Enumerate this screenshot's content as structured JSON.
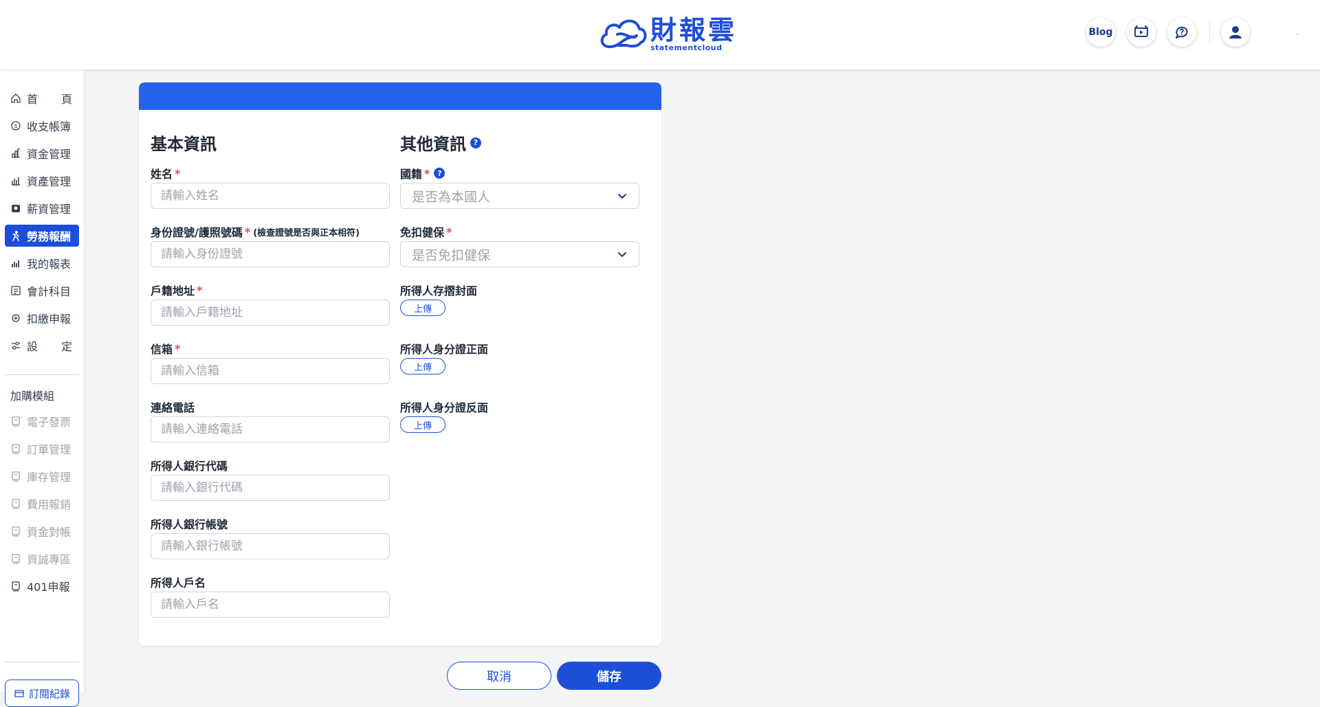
{
  "brand": {
    "name": "財報雲",
    "subtitle": "statementcloud",
    "color": "#1d4ed8"
  },
  "header": {
    "blog_label": "Blog",
    "icons": [
      "video-guide-icon",
      "chat-help-icon",
      "user-icon"
    ],
    "trailing_mark": "."
  },
  "sidebar": {
    "items": [
      {
        "label": "首",
        "label2": "頁",
        "icon": "home-icon"
      },
      {
        "label": "收支帳簿",
        "icon": "ledger-icon"
      },
      {
        "label": "資金管理",
        "icon": "funds-icon"
      },
      {
        "label": "資產管理",
        "icon": "assets-icon"
      },
      {
        "label": "薪資管理",
        "icon": "payroll-icon"
      },
      {
        "label": "勞務報酬",
        "icon": "labor-icon",
        "active": true
      },
      {
        "label": "我的報表",
        "icon": "report-icon"
      },
      {
        "label": "會計科目",
        "icon": "accounts-icon"
      },
      {
        "label": "扣繳申報",
        "icon": "withholding-icon"
      },
      {
        "label": "設",
        "label2": "定",
        "icon": "settings-icon"
      }
    ],
    "addon_title": "加購模組",
    "addons": [
      {
        "label": "電子發票",
        "disabled": true
      },
      {
        "label": "訂單管理",
        "disabled": true
      },
      {
        "label": "庫存管理",
        "disabled": true
      },
      {
        "label": "費用報銷",
        "disabled": true
      },
      {
        "label": "資金對帳",
        "disabled": true
      },
      {
        "label": "資誠專區",
        "disabled": true
      },
      {
        "label": "401申報",
        "disabled": false
      }
    ],
    "subscribe_label": "訂閱紀錄"
  },
  "form": {
    "basic_title": "基本資訊",
    "other_title": "其他資訊",
    "fields": {
      "name": {
        "label": "姓名",
        "placeholder": "請輸入姓名",
        "required": "*"
      },
      "id": {
        "label": "身份證號/護照號碼",
        "required": "*",
        "hint": "(檢查證號是否與正本相符)",
        "placeholder": "請輸入身份證號"
      },
      "address": {
        "label": "戶籍地址",
        "required": "*",
        "placeholder": "請輸入戶籍地址"
      },
      "email": {
        "label": "信箱",
        "required": "*",
        "placeholder": "請輸入信箱"
      },
      "phone": {
        "label": "連絡電話",
        "placeholder": "請輸入連絡電話"
      },
      "bank_code": {
        "label": "所得人銀行代碼",
        "placeholder": "請輸入銀行代碼"
      },
      "bank_account": {
        "label": "所得人銀行帳號",
        "placeholder": "請輸入銀行帳號"
      },
      "account_name": {
        "label": "所得人戶名",
        "placeholder": "請輸入戶名"
      }
    },
    "nationality": {
      "label": "國籍",
      "required": "*",
      "placeholder": "是否為本國人"
    },
    "insurance": {
      "label": "免扣健保",
      "required": "*",
      "placeholder": "是否免扣健保"
    },
    "uploads": [
      {
        "label": "所得人存摺封面",
        "button": "上傳"
      },
      {
        "label": "所得人身分證正面",
        "button": "上傳"
      },
      {
        "label": "所得人身分證反面",
        "button": "上傳"
      }
    ],
    "cancel_label": "取消",
    "save_label": "儲存"
  }
}
